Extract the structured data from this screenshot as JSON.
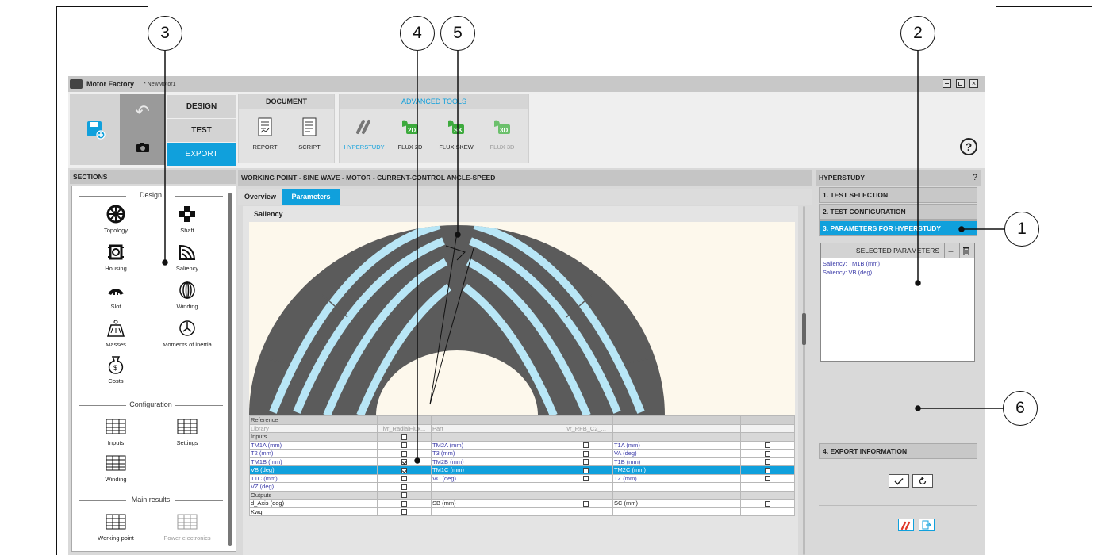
{
  "app": {
    "name": "Motor Factory",
    "document": "* NewMotor1"
  },
  "callouts": [
    "1",
    "2",
    "3",
    "4",
    "5",
    "6"
  ],
  "ribbon": {
    "modes": [
      "DESIGN",
      "TEST",
      "EXPORT"
    ],
    "document_group": {
      "title": "DOCUMENT",
      "tools": [
        "REPORT",
        "SCRIPT"
      ]
    },
    "advanced_group": {
      "title": "ADVANCED TOOLS",
      "tools": [
        "HYPERSTUDY",
        "FLUX 2D",
        "FLUX SKEW",
        "FLUX 3D"
      ]
    },
    "colors": {
      "accent": "#10a0dc",
      "flux_green": "#3daa3d"
    }
  },
  "sections": {
    "title": "SECTIONS",
    "design_header": "Design",
    "design_items": [
      "Topology",
      "Shaft",
      "Housing",
      "Saliency",
      "Slot",
      "Winding",
      "Masses",
      "Moments of inertia",
      "Costs"
    ],
    "configuration_header": "Configuration",
    "configuration_items": [
      "Inputs",
      "Settings",
      "Winding"
    ],
    "main_results_header": "Main results",
    "main_results_items": [
      "Working point",
      "Power electronics"
    ]
  },
  "work": {
    "title": "WORKING POINT - SINE WAVE - MOTOR - CURRENT-CONTROL ANGLE-SPEED",
    "tabs": [
      "Overview",
      "Parameters"
    ],
    "drawing_label": "Saliency",
    "table": {
      "header": [
        "Reference",
        "",
        "",
        "",
        "",
        ""
      ],
      "library": [
        "Library",
        "ivr_RadialFlux...",
        "Part",
        "ivr_RFB_C2_...",
        "",
        ""
      ],
      "inputs_label": "Inputs",
      "outputs_label": "Outputs",
      "input_rows": [
        [
          "TM1A (mm)",
          false,
          "TM2A (mm)",
          false,
          "T1A (mm)",
          false
        ],
        [
          "T2 (mm)",
          false,
          "T3 (mm)",
          false,
          "VA (deg)",
          false
        ],
        [
          "TM1B (mm)",
          true,
          "TM2B (mm)",
          false,
          "T1B (mm)",
          false
        ],
        [
          "VB (deg)",
          true,
          "TM1C (mm)",
          false,
          "TM2C (mm)",
          false
        ],
        [
          "T1C (mm)",
          false,
          "VC (deg)",
          false,
          "TZ (mm)",
          false
        ],
        [
          "VZ (deg)",
          false,
          "",
          null,
          "",
          null
        ]
      ],
      "output_rows": [
        [
          "d_Axis (deg)",
          false,
          "SB (mm)",
          false,
          "SC (mm)",
          false
        ],
        [
          "Kwq",
          false,
          "",
          null,
          "",
          null
        ]
      ],
      "selected_row": 3
    }
  },
  "hyperstudy": {
    "title": "HYPERSTUDY",
    "help": "?",
    "steps": [
      "1. TEST SELECTION",
      "2. TEST CONFIGURATION",
      "3. PARAMETERS FOR HYPERSTUDY",
      "4. EXPORT INFORMATION"
    ],
    "selected_title": "SELECTED PARAMETERS",
    "selected_parameters": [
      "Saliency: TM1B (mm)",
      "Saliency: VB (deg)"
    ]
  }
}
